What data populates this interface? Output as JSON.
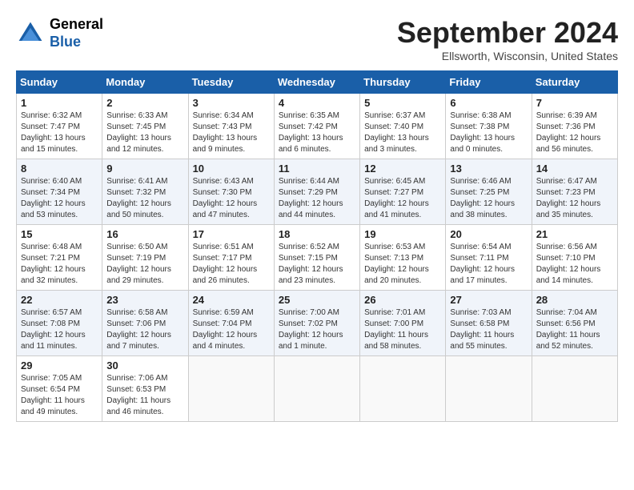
{
  "header": {
    "logo_line1": "General",
    "logo_line2": "Blue",
    "title": "September 2024",
    "subtitle": "Ellsworth, Wisconsin, United States"
  },
  "weekdays": [
    "Sunday",
    "Monday",
    "Tuesday",
    "Wednesday",
    "Thursday",
    "Friday",
    "Saturday"
  ],
  "weeks": [
    [
      {
        "day": "1",
        "info": "Sunrise: 6:32 AM\nSunset: 7:47 PM\nDaylight: 13 hours\nand 15 minutes."
      },
      {
        "day": "2",
        "info": "Sunrise: 6:33 AM\nSunset: 7:45 PM\nDaylight: 13 hours\nand 12 minutes."
      },
      {
        "day": "3",
        "info": "Sunrise: 6:34 AM\nSunset: 7:43 PM\nDaylight: 13 hours\nand 9 minutes."
      },
      {
        "day": "4",
        "info": "Sunrise: 6:35 AM\nSunset: 7:42 PM\nDaylight: 13 hours\nand 6 minutes."
      },
      {
        "day": "5",
        "info": "Sunrise: 6:37 AM\nSunset: 7:40 PM\nDaylight: 13 hours\nand 3 minutes."
      },
      {
        "day": "6",
        "info": "Sunrise: 6:38 AM\nSunset: 7:38 PM\nDaylight: 13 hours\nand 0 minutes."
      },
      {
        "day": "7",
        "info": "Sunrise: 6:39 AM\nSunset: 7:36 PM\nDaylight: 12 hours\nand 56 minutes."
      }
    ],
    [
      {
        "day": "8",
        "info": "Sunrise: 6:40 AM\nSunset: 7:34 PM\nDaylight: 12 hours\nand 53 minutes."
      },
      {
        "day": "9",
        "info": "Sunrise: 6:41 AM\nSunset: 7:32 PM\nDaylight: 12 hours\nand 50 minutes."
      },
      {
        "day": "10",
        "info": "Sunrise: 6:43 AM\nSunset: 7:30 PM\nDaylight: 12 hours\nand 47 minutes."
      },
      {
        "day": "11",
        "info": "Sunrise: 6:44 AM\nSunset: 7:29 PM\nDaylight: 12 hours\nand 44 minutes."
      },
      {
        "day": "12",
        "info": "Sunrise: 6:45 AM\nSunset: 7:27 PM\nDaylight: 12 hours\nand 41 minutes."
      },
      {
        "day": "13",
        "info": "Sunrise: 6:46 AM\nSunset: 7:25 PM\nDaylight: 12 hours\nand 38 minutes."
      },
      {
        "day": "14",
        "info": "Sunrise: 6:47 AM\nSunset: 7:23 PM\nDaylight: 12 hours\nand 35 minutes."
      }
    ],
    [
      {
        "day": "15",
        "info": "Sunrise: 6:48 AM\nSunset: 7:21 PM\nDaylight: 12 hours\nand 32 minutes."
      },
      {
        "day": "16",
        "info": "Sunrise: 6:50 AM\nSunset: 7:19 PM\nDaylight: 12 hours\nand 29 minutes."
      },
      {
        "day": "17",
        "info": "Sunrise: 6:51 AM\nSunset: 7:17 PM\nDaylight: 12 hours\nand 26 minutes."
      },
      {
        "day": "18",
        "info": "Sunrise: 6:52 AM\nSunset: 7:15 PM\nDaylight: 12 hours\nand 23 minutes."
      },
      {
        "day": "19",
        "info": "Sunrise: 6:53 AM\nSunset: 7:13 PM\nDaylight: 12 hours\nand 20 minutes."
      },
      {
        "day": "20",
        "info": "Sunrise: 6:54 AM\nSunset: 7:11 PM\nDaylight: 12 hours\nand 17 minutes."
      },
      {
        "day": "21",
        "info": "Sunrise: 6:56 AM\nSunset: 7:10 PM\nDaylight: 12 hours\nand 14 minutes."
      }
    ],
    [
      {
        "day": "22",
        "info": "Sunrise: 6:57 AM\nSunset: 7:08 PM\nDaylight: 12 hours\nand 11 minutes."
      },
      {
        "day": "23",
        "info": "Sunrise: 6:58 AM\nSunset: 7:06 PM\nDaylight: 12 hours\nand 7 minutes."
      },
      {
        "day": "24",
        "info": "Sunrise: 6:59 AM\nSunset: 7:04 PM\nDaylight: 12 hours\nand 4 minutes."
      },
      {
        "day": "25",
        "info": "Sunrise: 7:00 AM\nSunset: 7:02 PM\nDaylight: 12 hours\nand 1 minute."
      },
      {
        "day": "26",
        "info": "Sunrise: 7:01 AM\nSunset: 7:00 PM\nDaylight: 11 hours\nand 58 minutes."
      },
      {
        "day": "27",
        "info": "Sunrise: 7:03 AM\nSunset: 6:58 PM\nDaylight: 11 hours\nand 55 minutes."
      },
      {
        "day": "28",
        "info": "Sunrise: 7:04 AM\nSunset: 6:56 PM\nDaylight: 11 hours\nand 52 minutes."
      }
    ],
    [
      {
        "day": "29",
        "info": "Sunrise: 7:05 AM\nSunset: 6:54 PM\nDaylight: 11 hours\nand 49 minutes."
      },
      {
        "day": "30",
        "info": "Sunrise: 7:06 AM\nSunset: 6:53 PM\nDaylight: 11 hours\nand 46 minutes."
      },
      {
        "day": "",
        "info": ""
      },
      {
        "day": "",
        "info": ""
      },
      {
        "day": "",
        "info": ""
      },
      {
        "day": "",
        "info": ""
      },
      {
        "day": "",
        "info": ""
      }
    ]
  ]
}
